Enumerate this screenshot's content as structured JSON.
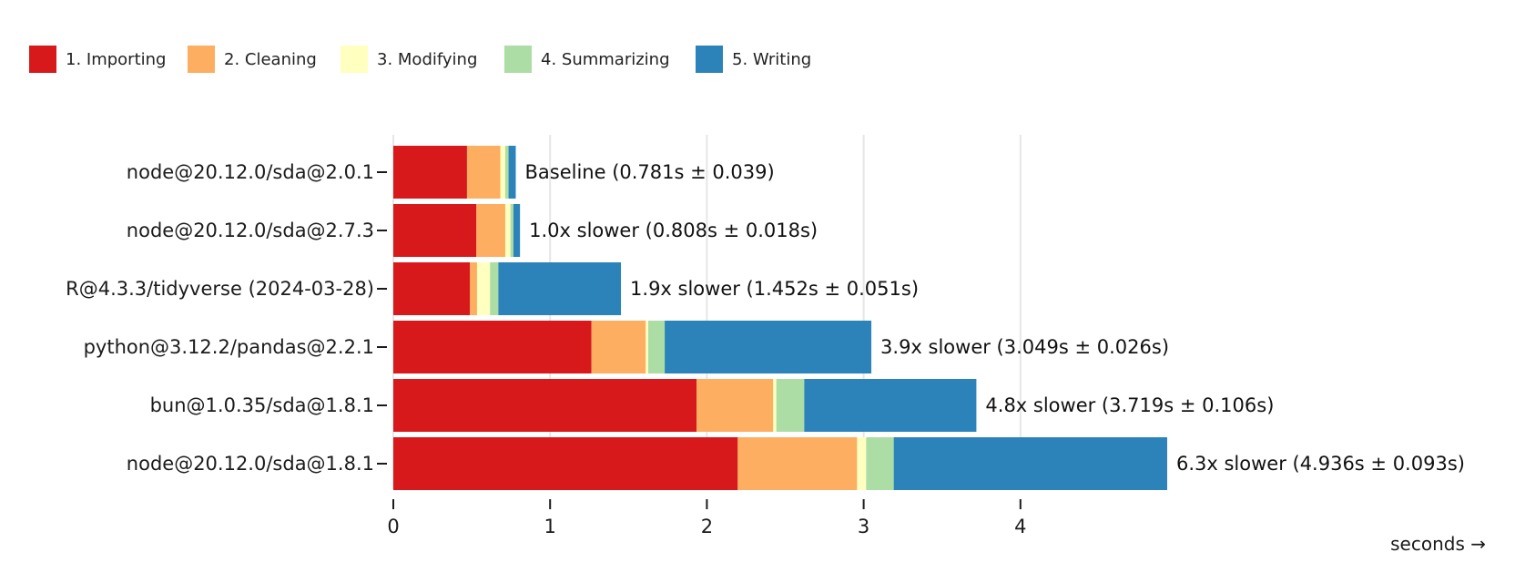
{
  "chart_data": {
    "type": "bar",
    "orientation": "horizontal",
    "stacked": true,
    "title": "",
    "xlabel": "seconds →",
    "ylabel": "",
    "xlim": [
      0,
      4.936
    ],
    "x_ticks": [
      0,
      1,
      2,
      3,
      4
    ],
    "grid": true,
    "legend_position": "top-left",
    "categories": [
      "node@20.12.0/sda@2.0.1",
      "node@20.12.0/sda@2.7.3",
      "R@4.3.3/tidyverse (2024-03-28)",
      "python@3.12.2/pandas@2.2.1",
      "bun@1.0.35/sda@1.8.1",
      "node@20.12.0/sda@1.8.1"
    ],
    "series": [
      {
        "name": "1. Importing",
        "color": "#d7191c",
        "values": [
          0.47,
          0.53,
          0.488,
          1.264,
          1.934,
          2.197
        ]
      },
      {
        "name": "2. Cleaning",
        "color": "#fdae61",
        "values": [
          0.213,
          0.184,
          0.046,
          0.346,
          0.489,
          0.761
        ]
      },
      {
        "name": "3. Modifying",
        "color": "#ffffbf",
        "values": [
          0.031,
          0.033,
          0.083,
          0.016,
          0.02,
          0.058
        ]
      },
      {
        "name": "4. Summarizing",
        "color": "#abdda4",
        "values": [
          0.021,
          0.019,
          0.053,
          0.105,
          0.178,
          0.176
        ]
      },
      {
        "name": "5. Writing",
        "color": "#2b83ba",
        "values": [
          0.046,
          0.042,
          0.782,
          1.318,
          1.098,
          1.744
        ]
      }
    ],
    "totals": [
      0.781,
      0.808,
      1.452,
      3.049,
      3.719,
      4.936
    ],
    "annotations": [
      "Baseline (0.781s ± 0.039)",
      "1.0x slower (0.808s ± 0.018s)",
      "1.9x slower (1.452s ± 0.051s)",
      "3.9x slower (3.049s ± 0.026s)",
      "4.8x slower (3.719s ± 0.106s)",
      "6.3x slower (4.936s ± 0.093s)"
    ]
  }
}
